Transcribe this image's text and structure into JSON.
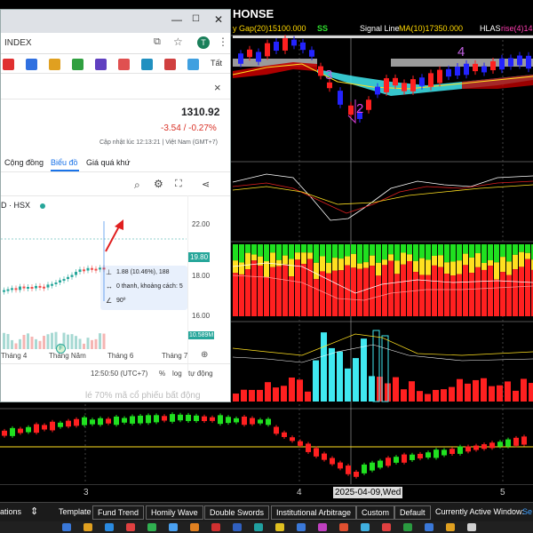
{
  "trading": {
    "title": "HONSE",
    "gap_label": "y Gap(20)15100.000",
    "ss_label": "SS",
    "signal_label": "Signal Line",
    "signal_value": "MA(10)17350.000",
    "hlas_label": "HLAS",
    "hlas_value": "rise(4)14",
    "wave_labels": [
      "3",
      "2",
      "4"
    ],
    "x_ticks": [
      "3",
      "4",
      "5"
    ],
    "x_date": "2025-04-09,Wed",
    "colors": {
      "up_candle": "#2323ff",
      "down_candle": "#ff2020",
      "cyan": "#40e8f0",
      "yellow": "#ffe020",
      "green": "#20e020",
      "magenta": "#e040e0"
    }
  },
  "toolbar": {
    "items": [
      "ations",
      "Template",
      "Fund Trend",
      "Homily Wave",
      "Double Swords",
      "Institutional Arbitrage",
      "Custom",
      "Default"
    ],
    "status_label": "Currently Active Window:",
    "status_value": "Se"
  },
  "browser": {
    "tab_title": "INDEX",
    "avatar_letter": "T",
    "bookmarks_more": "Tất",
    "close_symbol": "×",
    "price": "1310.92",
    "change": "-3.54 / -0.27%",
    "updated": "Cập nhật lúc  12:13:21 | Việt Nam (GMT+7)",
    "tabs": [
      "Cộng đồng",
      "Biểu đồ",
      "Giá quá khứ"
    ],
    "active_tab": "Biểu đồ",
    "symbol": "D · HSX",
    "y_labels": [
      "22.00",
      "18.00",
      "16.00"
    ],
    "price_tag": "19.80",
    "volume_tag": "10.589M",
    "x_labels": [
      "Tháng 4",
      "Tháng Năm",
      "Tháng 6",
      "Tháng 7"
    ],
    "measure": {
      "line1": "1.88 (10.46%), 188",
      "line2": "0 thanh, khoảng cách: 5",
      "line3": "90º"
    },
    "clock": "12:50:50 (UTC+7)",
    "pct": "%",
    "log": "log",
    "auto": "tự động",
    "background_text": "lé 70%  mã cổ phiếu bất động"
  }
}
